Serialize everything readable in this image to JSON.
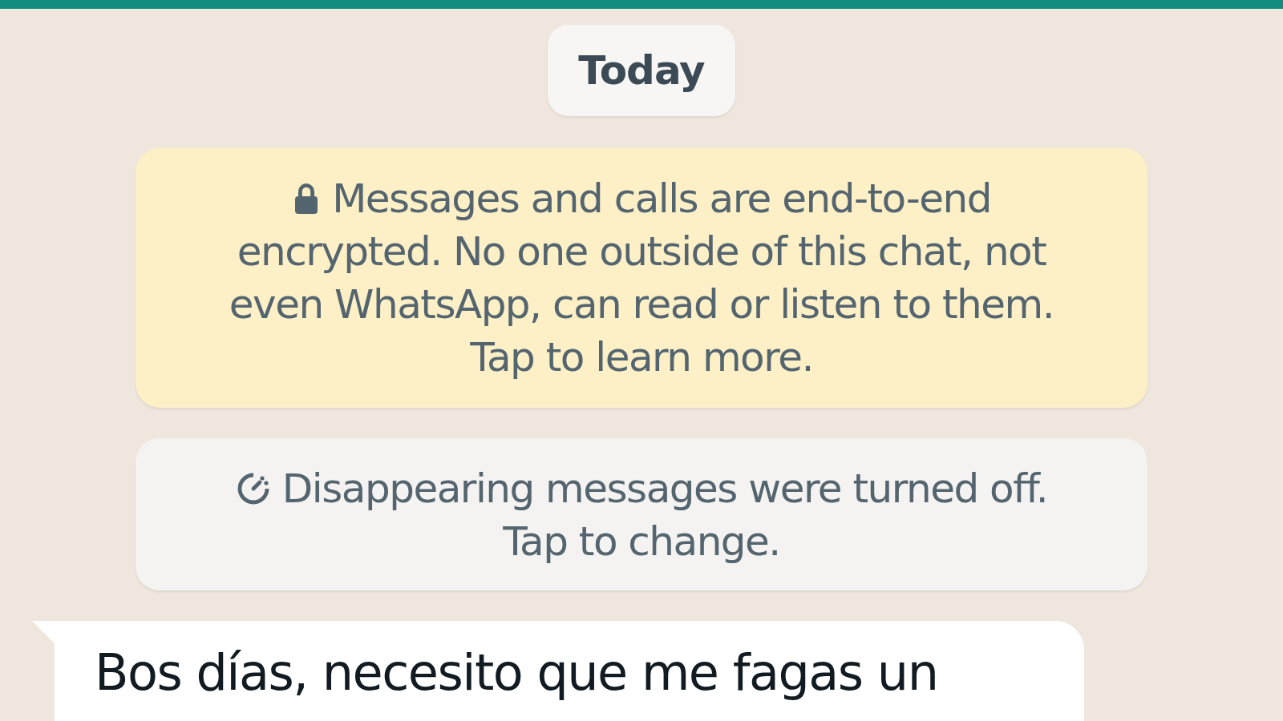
{
  "date_chip": "Today",
  "notices": [
    {
      "kind": "encryption",
      "lines": [
        "Messages and calls are end-to-end",
        "encrypted. No one outside of this chat, not",
        "even WhatsApp, can read or listen to them.",
        "Tap to learn more."
      ]
    },
    {
      "kind": "disappearing",
      "lines": [
        "Disappearing messages were turned off.",
        "Tap to change."
      ]
    }
  ],
  "messages": [
    {
      "text": "Bos días, necesito que me fagas un"
    }
  ]
}
